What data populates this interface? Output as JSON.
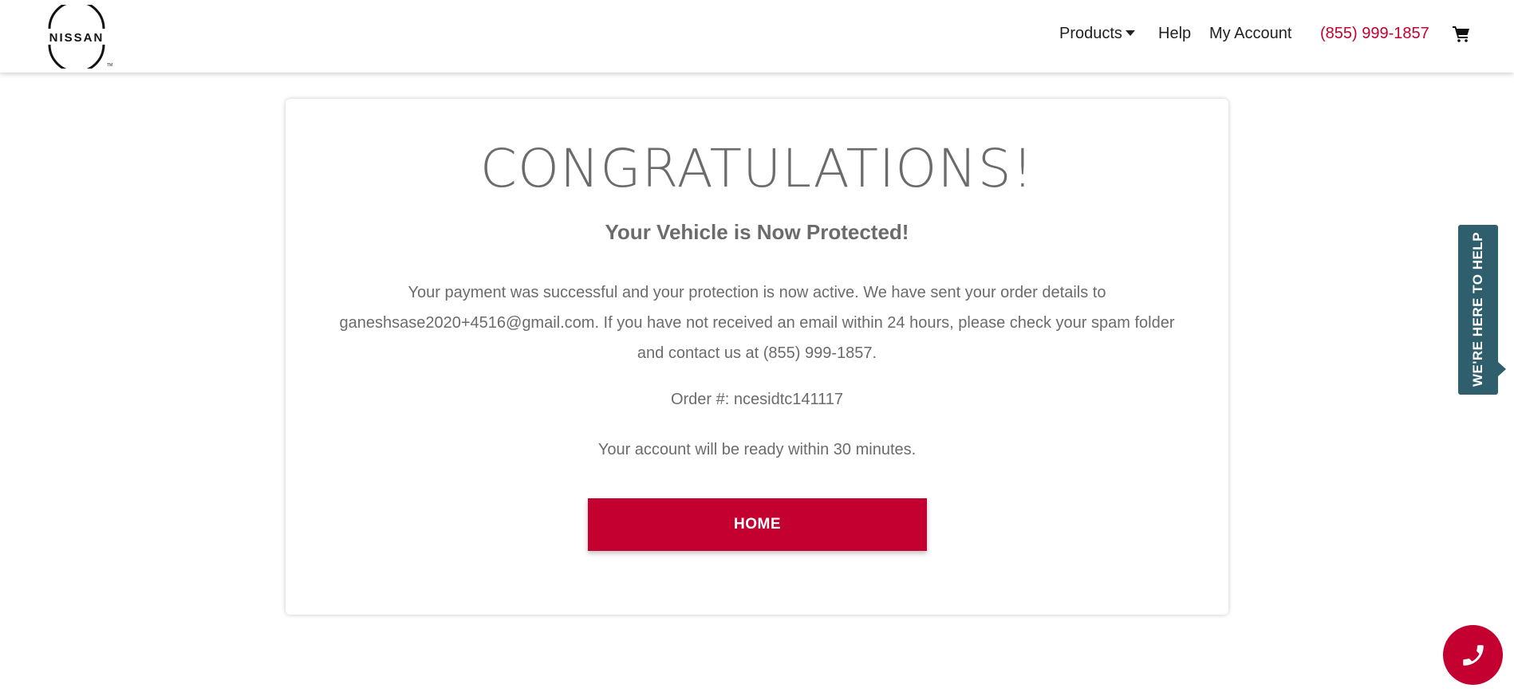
{
  "header": {
    "brand": "NISSAN",
    "nav": {
      "products": "Products",
      "help": "Help",
      "my_account": "My Account",
      "phone": "(855) 999-1857"
    },
    "cart_icon": "shopping-cart-icon"
  },
  "confirmation": {
    "title": "CONGRATULATIONS!",
    "subtitle": "Your Vehicle is Now Protected!",
    "message": "Your payment was successful and your protection is now active. We have sent your order details to ganeshsase2020+4516@gmail.com. If you have not received an email within 24 hours, please check your spam folder and contact us at (855) 999-1857.",
    "order": "Order #: ncesidtc141117",
    "ready": "Your account will be ready within 30 minutes.",
    "home_button": "HOME"
  },
  "help_tab": {
    "label": "WE'RE HERE TO HELP"
  },
  "call_button_icon": "phone-icon",
  "colors": {
    "accent": "#c3002f",
    "help_tab": "#2f5f6c",
    "text": "#6b6b6b"
  }
}
